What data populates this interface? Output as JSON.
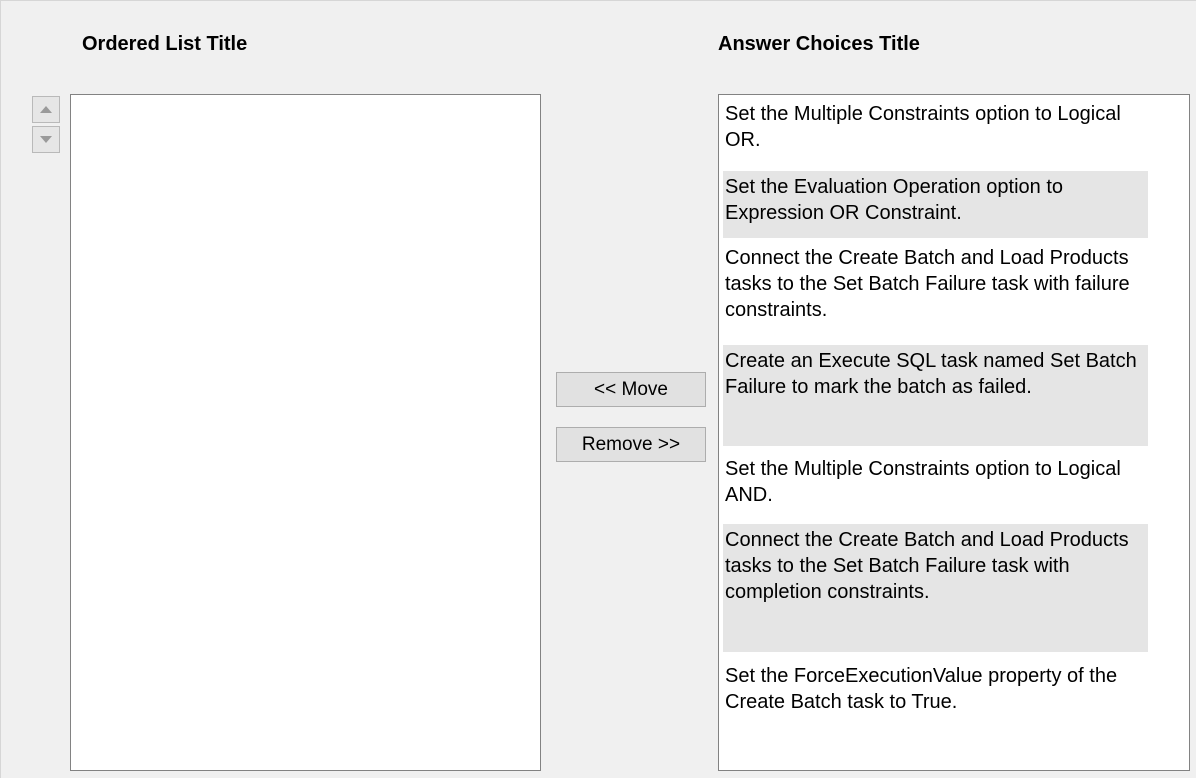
{
  "ordered_list": {
    "title": "Ordered List Title",
    "items": []
  },
  "answer_choices": {
    "title": "Answer Choices Title",
    "items": [
      "Set the Multiple Constraints option to Logical OR.",
      "Set the Evaluation Operation option to Expression OR Constraint.",
      "Connect the Create Batch and Load Products tasks to the Set Batch Failure task with failure constraints.",
      "Create an Execute SQL task named Set Batch Failure to mark the batch as failed.",
      "Set the Multiple Constraints option to Logical AND.",
      "Connect the Create Batch and Load Products tasks to the Set Batch Failure task with completion constraints.",
      "Set the ForceExecutionValue property of the Create Batch task to True."
    ]
  },
  "buttons": {
    "move_label": "<< Move",
    "remove_label": "Remove >>"
  },
  "icons": {
    "move_up": "up-arrow-icon",
    "move_down": "down-arrow-icon"
  },
  "colors": {
    "background": "#f0f0f0",
    "list_background": "#ffffff",
    "alternate_row": "#e5e5e5",
    "button_face": "#e1e1e1",
    "arrow_gray": "#9a9a9a"
  }
}
